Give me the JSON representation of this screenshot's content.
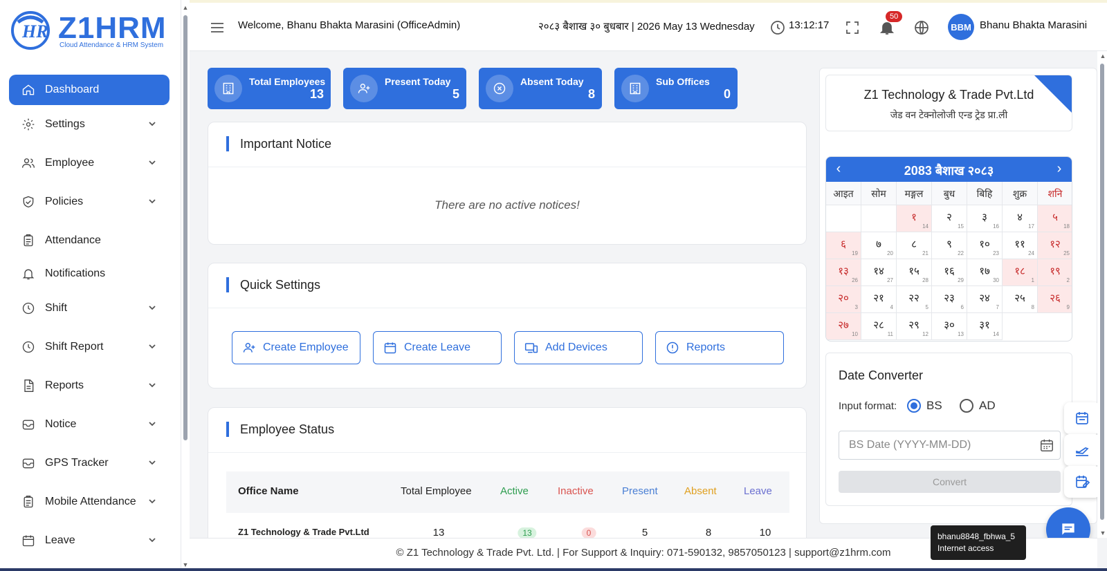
{
  "brand": {
    "name": "Z1HRM",
    "tagline": "Cloud Attendance & HRM System"
  },
  "sidebar": {
    "items": [
      {
        "label": "Dashboard",
        "icon": "home-icon",
        "active": true,
        "expandable": false
      },
      {
        "label": "Settings",
        "icon": "gear-icon",
        "expandable": true
      },
      {
        "label": "Employee",
        "icon": "users-icon",
        "expandable": true
      },
      {
        "label": "Policies",
        "icon": "shield-check-icon",
        "expandable": true
      },
      {
        "label": "Attendance",
        "icon": "clipboard-icon",
        "expandable": false
      },
      {
        "label": "Notifications",
        "icon": "bell-icon",
        "expandable": false
      },
      {
        "label": "Shift",
        "icon": "clock-icon",
        "expandable": true
      },
      {
        "label": "Shift Report",
        "icon": "clock-icon",
        "expandable": true
      },
      {
        "label": "Reports",
        "icon": "document-icon",
        "expandable": true
      },
      {
        "label": "Notice",
        "icon": "inbox-icon",
        "expandable": true
      },
      {
        "label": "GPS Tracker",
        "icon": "inbox-icon",
        "expandable": true
      },
      {
        "label": "Mobile Attendance",
        "icon": "clipboard-icon",
        "expandable": true
      },
      {
        "label": "Leave",
        "icon": "calendar-icon",
        "expandable": true
      }
    ]
  },
  "header": {
    "welcome": "Welcome, Bhanu Bhakta Marasini (OfficeAdmin)",
    "date": "२०८३ बैशाख ३० बुधबार | 2026 May 13 Wednesday",
    "time": "13:12:17",
    "notification_count": "50",
    "avatar_initials": "BBM",
    "user_name": "Bhanu Bhakta Marasini"
  },
  "stats": [
    {
      "label": "Total Employees",
      "value": "13",
      "icon": "building-icon"
    },
    {
      "label": "Present Today",
      "value": "5",
      "icon": "user-plus-icon"
    },
    {
      "label": "Absent Today",
      "value": "8",
      "icon": "x-circle-icon"
    },
    {
      "label": "Sub Offices",
      "value": "0",
      "icon": "building-icon"
    }
  ],
  "notice": {
    "title": "Important Notice",
    "empty_text": "There are no active notices!"
  },
  "quick_settings": {
    "title": "Quick Settings",
    "buttons": [
      {
        "label": "Create Employee",
        "icon": "user-plus-icon"
      },
      {
        "label": "Create Leave",
        "icon": "calendar-icon"
      },
      {
        "label": "Add Devices",
        "icon": "devices-icon"
      },
      {
        "label": "Reports",
        "icon": "alert-circle-icon"
      }
    ]
  },
  "employee_status": {
    "title": "Employee Status",
    "columns": [
      "Office Name",
      "Total Employee",
      "Active",
      "Inactive",
      "Present",
      "Absent",
      "Leave"
    ],
    "column_colors": [
      "#222222",
      "#222222",
      "#2e9d4f",
      "#d9534f",
      "#4a7fd4",
      "#e0a020",
      "#6a6fd0"
    ],
    "rows": [
      {
        "office": "Z1 Technology & Trade Pvt.Ltd",
        "total": "13",
        "active": "13",
        "inactive": "0",
        "present": "5",
        "absent": "8",
        "leave": "10"
      }
    ]
  },
  "company": {
    "name": "Z1 Technology & Trade Pvt.Ltd",
    "name_np": "जेड वन टेक्नोलोजी एन्ड ट्रेड प्रा.ली"
  },
  "calendar": {
    "title": "2083 बैशाख २०८३",
    "weekdays": [
      "आइत",
      "सोम",
      "मङ्गल",
      "बुध",
      "बिहि",
      "शुक्र",
      "शनि"
    ],
    "days": [
      {
        "np": "१",
        "en": "14",
        "holiday": true
      },
      {
        "np": "२",
        "en": "15",
        "holiday": false
      },
      {
        "np": "३",
        "en": "16",
        "holiday": false
      },
      {
        "np": "४",
        "en": "17",
        "holiday": false
      },
      {
        "np": "५",
        "en": "18",
        "holiday": true
      },
      {
        "np": "६",
        "en": "19",
        "holiday": true
      },
      {
        "np": "७",
        "en": "20",
        "holiday": false
      },
      {
        "np": "८",
        "en": "21",
        "holiday": false
      },
      {
        "np": "९",
        "en": "22",
        "holiday": false
      },
      {
        "np": "१०",
        "en": "23",
        "holiday": false
      },
      {
        "np": "११",
        "en": "24",
        "holiday": false
      },
      {
        "np": "१२",
        "en": "25",
        "holiday": true
      },
      {
        "np": "१३",
        "en": "26",
        "holiday": true
      },
      {
        "np": "१४",
        "en": "27",
        "holiday": false
      },
      {
        "np": "१५",
        "en": "28",
        "holiday": false
      },
      {
        "np": "१६",
        "en": "29",
        "holiday": false
      },
      {
        "np": "१७",
        "en": "30",
        "holiday": false
      },
      {
        "np": "१८",
        "en": "1",
        "holiday": true
      },
      {
        "np": "१९",
        "en": "2",
        "holiday": true
      },
      {
        "np": "२०",
        "en": "3",
        "holiday": true
      },
      {
        "np": "२१",
        "en": "4",
        "holiday": false
      },
      {
        "np": "२२",
        "en": "5",
        "holiday": false
      },
      {
        "np": "२३",
        "en": "6",
        "holiday": false
      },
      {
        "np": "२४",
        "en": "7",
        "holiday": false
      },
      {
        "np": "२५",
        "en": "8",
        "holiday": false
      },
      {
        "np": "२६",
        "en": "9",
        "holiday": true
      },
      {
        "np": "२७",
        "en": "10",
        "holiday": true
      },
      {
        "np": "२८",
        "en": "11",
        "holiday": false
      },
      {
        "np": "२९",
        "en": "12",
        "holiday": false
      },
      {
        "np": "३०",
        "en": "13",
        "holiday": false
      },
      {
        "np": "३१",
        "en": "14",
        "holiday": false
      }
    ]
  },
  "converter": {
    "title": "Date Converter",
    "input_format_label": "Input format:",
    "options": [
      "BS",
      "AD"
    ],
    "selected": "BS",
    "placeholder": "BS Date (YYYY-MM-DD)",
    "button": "Convert"
  },
  "footer": {
    "text": "© Z1 Technology & Trade Pvt. Ltd. | For Support & Inquiry: 071-590132, 9857050123 | support@z1hrm.com"
  },
  "tooltip": {
    "line1": "bhanu8848_fbhwa_5",
    "line2": "Internet access"
  },
  "colors": {
    "primary": "#2f6fdd",
    "holiday_bg": "#fde8e8",
    "holiday_text": "#c62828"
  }
}
